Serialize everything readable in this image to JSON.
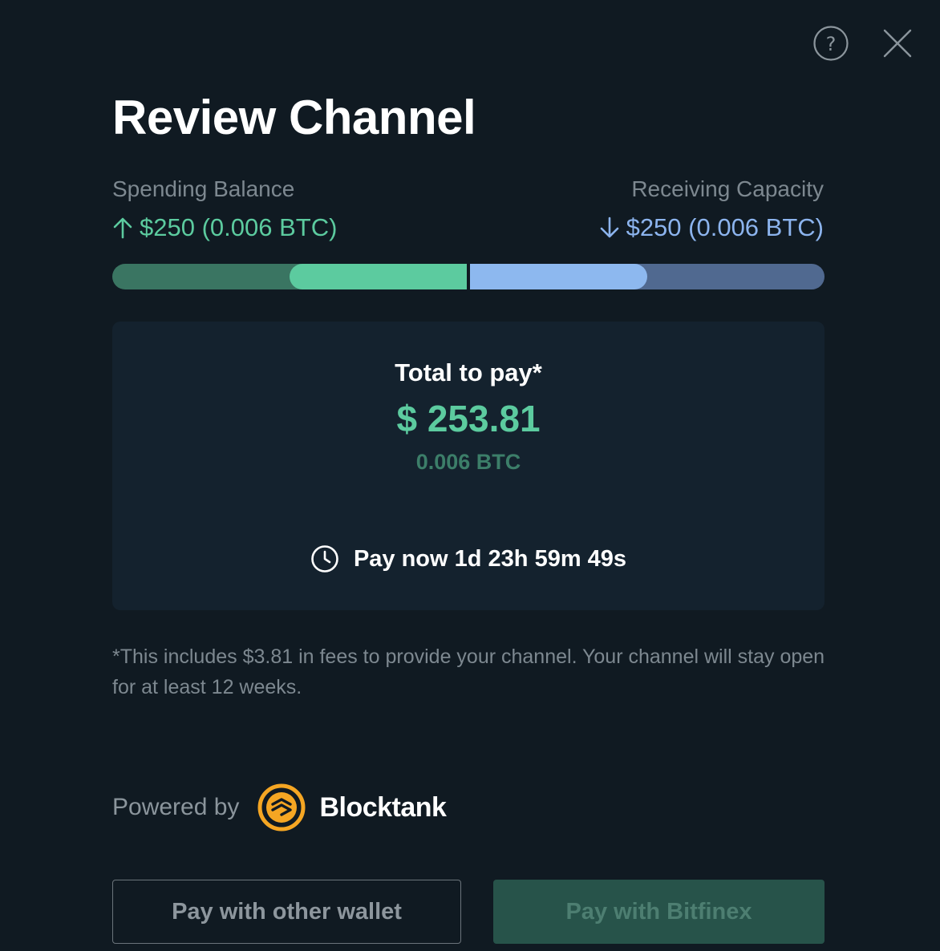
{
  "header": {
    "help_icon": "question-circle-icon",
    "close_icon": "close-icon"
  },
  "title": "Review Channel",
  "balances": {
    "spending_label": "Spending Balance",
    "spending_value": "$250 (0.006 BTC)",
    "spending_icon": "arrow-up-icon",
    "receiving_label": "Receiving Capacity",
    "receiving_value": "$250 (0.006 BTC)",
    "receiving_icon": "arrow-down-icon",
    "spending_fill_fraction": 0.5,
    "receiving_fill_fraction": 0.5
  },
  "payment": {
    "total_label": "Total to pay*",
    "total_usd": "$ 253.81",
    "total_btc": "0.006 BTC",
    "countdown_icon": "clock-icon",
    "countdown_text": "Pay now 1d 23h 59m 49s"
  },
  "fee_note": "*This includes $3.81 in fees to provide your channel. Your channel will stay open for at least 12 weeks.",
  "powered_by": {
    "label": "Powered by",
    "brand": "Blocktank",
    "brand_icon": "blocktank-logo-icon"
  },
  "actions": {
    "other_wallet_label": "Pay with other wallet",
    "bitfinex_label": "Pay with Bitfinex"
  },
  "colors": {
    "background": "#101a22",
    "card": "#14222e",
    "spending_accent": "#5ccb9f",
    "receiving_accent": "#8cb4ee",
    "muted_text": "#7d8890",
    "brand_orange": "#f5a623"
  }
}
